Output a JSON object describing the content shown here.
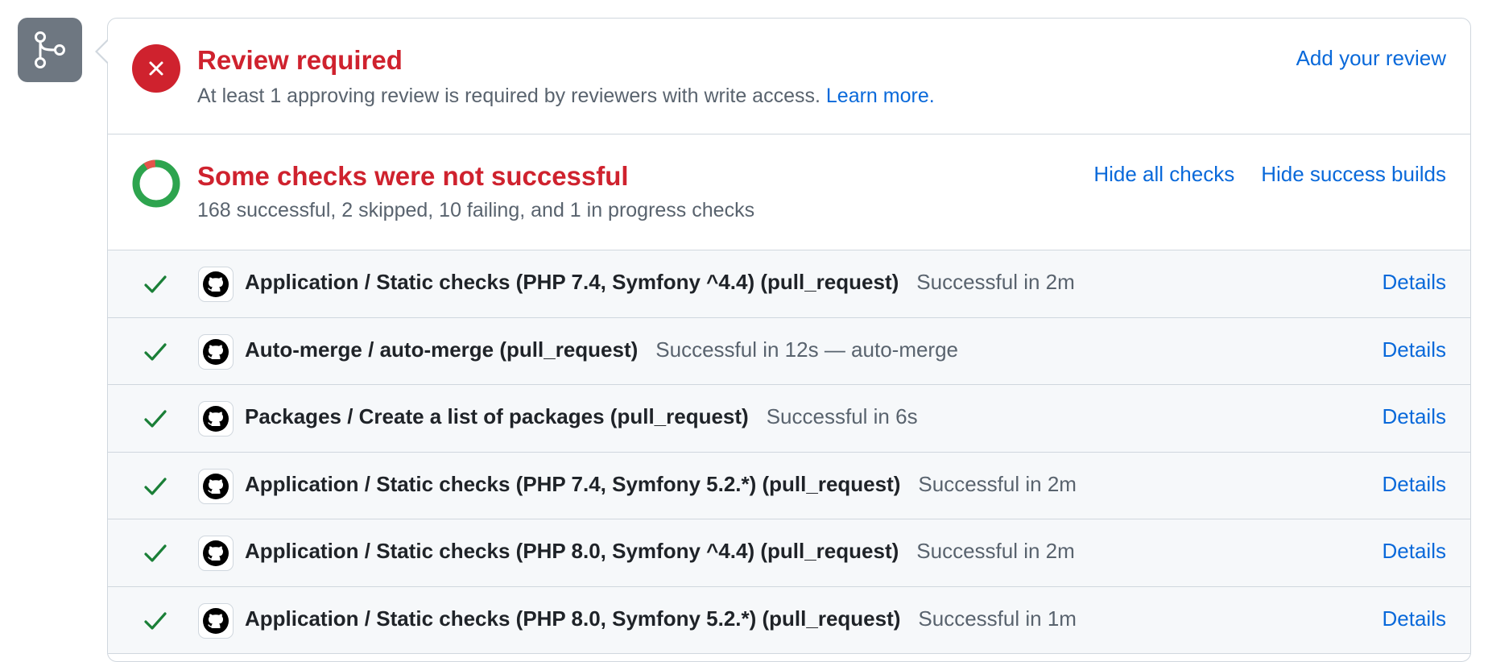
{
  "merge_icon": "git-merge-icon",
  "review": {
    "status_icon": "x-icon",
    "title": "Review required",
    "description": "At least 1 approving review is required by reviewers with write access.",
    "learn_more": "Learn more.",
    "add_review": "Add your review"
  },
  "checks": {
    "status_icon": "donut-progress-icon",
    "title": "Some checks were not successful",
    "summary": "168 successful, 2 skipped, 10 failing, and 1 in progress checks",
    "hide_all": "Hide all checks",
    "hide_success": "Hide success builds",
    "rows": [
      {
        "name": "Application / Static checks (PHP 7.4, Symfony ^4.4) (pull_request)",
        "status": "Successful in 2m",
        "details": "Details",
        "icon": "check-icon"
      },
      {
        "name": "Auto-merge / auto-merge (pull_request)",
        "status": "Successful in 12s — auto-merge",
        "details": "Details",
        "icon": "check-icon"
      },
      {
        "name": "Packages / Create a list of packages (pull_request)",
        "status": "Successful in 6s",
        "details": "Details",
        "icon": "check-icon"
      },
      {
        "name": "Application / Static checks (PHP 7.4, Symfony 5.2.*) (pull_request)",
        "status": "Successful in 2m",
        "details": "Details",
        "icon": "check-icon"
      },
      {
        "name": "Application / Static checks (PHP 8.0, Symfony ^4.4) (pull_request)",
        "status": "Successful in 2m",
        "details": "Details",
        "icon": "check-icon"
      },
      {
        "name": "Application / Static checks (PHP 8.0, Symfony 5.2.*) (pull_request)",
        "status": "Successful in 1m",
        "details": "Details",
        "icon": "check-icon"
      }
    ]
  },
  "colors": {
    "danger": "#cf222e",
    "success": "#1a7f37",
    "link": "#0969da",
    "muted": "#59636e",
    "donut_success": "#2da44e"
  }
}
